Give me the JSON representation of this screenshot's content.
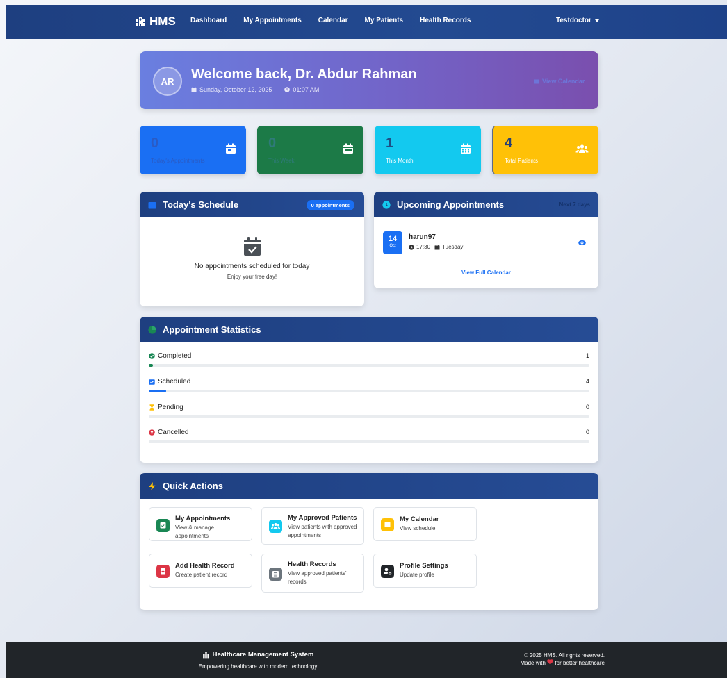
{
  "navbar": {
    "brand": "HMS",
    "links": [
      "Dashboard",
      "My Appointments",
      "Calendar",
      "My Patients",
      "Health Records"
    ],
    "user": "Testdoctor"
  },
  "welcome": {
    "initials": "AR",
    "title": "Welcome back, Dr. Abdur Rahman",
    "date": "Sunday, October 12, 2025",
    "time": "01:07 AM",
    "action": "View Calendar"
  },
  "stats": [
    {
      "value": "0",
      "label": "Today's Appointments"
    },
    {
      "value": "0",
      "label": "This Week"
    },
    {
      "value": "1",
      "label": "This Month"
    },
    {
      "value": "4",
      "label": "Total Patients"
    }
  ],
  "schedule": {
    "title": "Today's Schedule",
    "badge": "0 appointments",
    "empty_title": "No appointments scheduled for today",
    "empty_sub": "Enjoy your free day!"
  },
  "upcoming": {
    "title": "Upcoming Appointments",
    "note": "Next 7 days",
    "item": {
      "day": "14",
      "month": "Oct",
      "name": "harun97",
      "time": "17:30",
      "weekday": "Tuesday"
    },
    "link": "View Full Calendar"
  },
  "appointment_stats": {
    "title": "Appointment Statistics",
    "rows": [
      {
        "label": "Completed",
        "count": "1",
        "fraction": 0.01,
        "color": "#198754"
      },
      {
        "label": "Scheduled",
        "count": "4",
        "fraction": 0.04,
        "color": "#1a6ff3"
      },
      {
        "label": "Pending",
        "count": "0",
        "fraction": 0,
        "color": "#ffc107"
      },
      {
        "label": "Cancelled",
        "count": "0",
        "fraction": 0,
        "color": "#dc3545"
      }
    ]
  },
  "quick_actions": {
    "title": "Quick Actions",
    "items": [
      {
        "title": "My Appointments",
        "desc": "View & manage appointments",
        "color": "#198754"
      },
      {
        "title": "My Approved Patients",
        "desc": "View patients with approved appointments",
        "color": "#13c9ef"
      },
      {
        "title": "My Calendar",
        "desc": "View schedule",
        "color": "#ffc107"
      },
      {
        "title": "Add Health Record",
        "desc": "Create patient record",
        "color": "#dc3545"
      },
      {
        "title": "Health Records",
        "desc": "View approved patients' records",
        "color": "#6c757d"
      },
      {
        "title": "Profile Settings",
        "desc": "Update profile",
        "color": "#212529"
      }
    ]
  },
  "footer": {
    "title": "Healthcare Management System",
    "tagline": "Empowering healthcare with modern technology",
    "copyright": "© 2025 HMS. All rights reserved.",
    "made_prefix": "Made with",
    "made_suffix": "for better healthcare"
  }
}
